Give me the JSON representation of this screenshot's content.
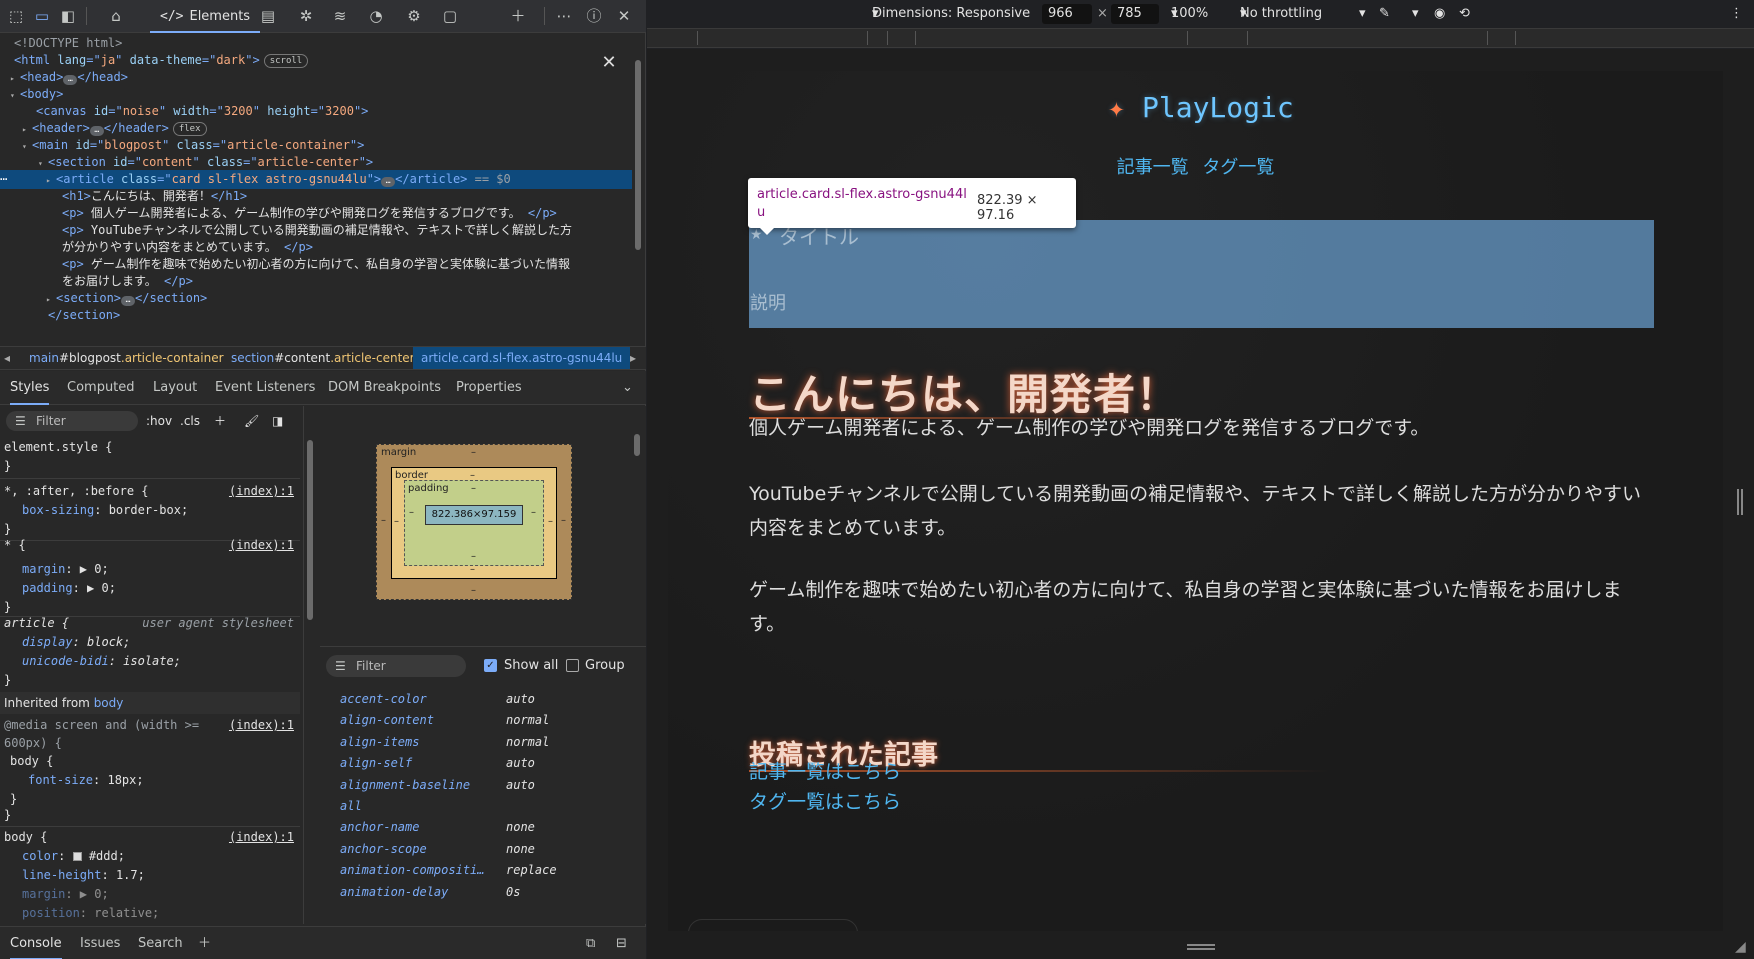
{
  "devtools": {
    "tabs": {
      "elements": "Elements"
    },
    "dom_lines": [
      {
        "parts": [
          [
            "c",
            "<!DOCTYPE html>"
          ]
        ]
      },
      {
        "parts": [
          [
            "t",
            "<html "
          ],
          [
            "a",
            "lang"
          ],
          [
            "t",
            "=\""
          ],
          [
            "v",
            "ja"
          ],
          [
            "t",
            "\" "
          ],
          [
            "a",
            "data-theme"
          ],
          [
            "t",
            "=\""
          ],
          [
            "v",
            "dark"
          ],
          [
            "t",
            "\">"
          ]
        ],
        "pill": "scroll"
      },
      {
        "parts": [
          [
            "t",
            "<head>"
          ],
          [
            "dots",
            "…"
          ],
          [
            "t",
            "</head>"
          ]
        ]
      },
      {
        "parts": [
          [
            "t",
            "<body>"
          ]
        ]
      },
      {
        "parts": [
          [
            "t",
            "<canvas "
          ],
          [
            "a",
            "id"
          ],
          [
            "t",
            "=\""
          ],
          [
            "v",
            "noise"
          ],
          [
            "t",
            "\" "
          ],
          [
            "a",
            "width"
          ],
          [
            "t",
            "=\""
          ],
          [
            "v",
            "3200"
          ],
          [
            "t",
            "\" "
          ],
          [
            "a",
            "height"
          ],
          [
            "t",
            "=\""
          ],
          [
            "v",
            "3200"
          ],
          [
            "t",
            "\">"
          ]
        ]
      },
      {
        "parts": [
          [
            "t",
            "<header>"
          ],
          [
            "dots",
            "…"
          ],
          [
            "t",
            "</header>"
          ]
        ],
        "pill": "flex"
      },
      {
        "parts": [
          [
            "t",
            "<main "
          ],
          [
            "a",
            "id"
          ],
          [
            "t",
            "=\""
          ],
          [
            "v",
            "blogpost"
          ],
          [
            "t",
            "\" "
          ],
          [
            "a",
            "class"
          ],
          [
            "t",
            "=\""
          ],
          [
            "v",
            "article-container"
          ],
          [
            "t",
            "\">"
          ]
        ]
      },
      {
        "parts": [
          [
            "t",
            "<section "
          ],
          [
            "a",
            "id"
          ],
          [
            "t",
            "=\""
          ],
          [
            "v",
            "content"
          ],
          [
            "t",
            "\" "
          ],
          [
            "a",
            "class"
          ],
          [
            "t",
            "=\""
          ],
          [
            "v",
            "article-center"
          ],
          [
            "t",
            "\">"
          ]
        ]
      },
      {
        "parts": [
          [
            "t",
            "<article "
          ],
          [
            "a",
            "class"
          ],
          [
            "t",
            "=\""
          ],
          [
            "v",
            "card sl-flex astro-gsnu44lu"
          ],
          [
            "t",
            "\">"
          ],
          [
            "dots",
            "…"
          ],
          [
            "t",
            "</article>"
          ],
          [
            "c",
            " == $0"
          ]
        ]
      },
      {
        "parts": [
          [
            "t",
            "<h1>"
          ],
          [
            "tx",
            "こんにちは、開発者！"
          ],
          [
            "t",
            "</h1>"
          ]
        ]
      },
      {
        "parts": [
          [
            "t",
            "<p>"
          ],
          [
            "tx",
            " 個人ゲーム開発者による、ゲーム制作の学びや開発ログを発信するブログです。 "
          ],
          [
            "t",
            "</p>"
          ]
        ]
      },
      {
        "parts": [
          [
            "t",
            "<p>"
          ],
          [
            "tx",
            " YouTubeチャンネルで公開している開発動画の補足情報や、テキストで詳しく解説した方"
          ]
        ]
      },
      {
        "parts": [
          [
            "tx",
            "が分かりやすい内容をまとめています。 "
          ],
          [
            "t",
            "</p>"
          ]
        ]
      },
      {
        "parts": [
          [
            "t",
            "<p>"
          ],
          [
            "tx",
            " ゲーム制作を趣味で始めたい初心者の方に向けて、私自身の学習と実体験に基づいた情報"
          ]
        ]
      },
      {
        "parts": [
          [
            "tx",
            "をお届けします。 "
          ],
          [
            "t",
            "</p>"
          ]
        ]
      },
      {
        "parts": [
          [
            "t",
            "<section>"
          ],
          [
            "dots",
            "…"
          ],
          [
            "t",
            "</section>"
          ]
        ]
      },
      {
        "parts": [
          [
            "t",
            "</section>"
          ]
        ]
      }
    ],
    "breadcrumbs": {
      "c1_tag": "main",
      "c1_id": "#blogpost",
      "c1_cls": ".article-container",
      "c2_tag": "section",
      "c2_id": "#content",
      "c2_cls": ".article-center",
      "c3": "article.card.sl-flex.astro-gsnu44lu"
    },
    "subtabs": [
      "Styles",
      "Computed",
      "Layout",
      "Event Listeners",
      "DOM Breakpoints",
      "Properties"
    ],
    "styles_filter": "Filter",
    "hov": ":hov",
    "cls": ".cls",
    "rules": {
      "element_style": "element.style {",
      "r1_sel": "*, :after, :before {",
      "r1_src": "(index):1",
      "r1_p1": "box-sizing",
      "r1_v1": "border-box;",
      "r2_sel": "* {",
      "r2_src": "(index):1",
      "r2_p1": "margin",
      "r2_v1": "0;",
      "r2_p2": "padding",
      "r2_v2": "0;",
      "r3_sel": "article {",
      "r3_ua": "user agent stylesheet",
      "r3_p1": "display",
      "r3_v1": "block;",
      "r3_p2": "unicode-bidi",
      "r3_v2": "isolate;",
      "inherited": "Inherited from",
      "inherited_el": "body",
      "r4_media": "@media screen and (width >=",
      "r4_media2": "600px) {",
      "r4_src": "(index):1",
      "r4_sel": "body {",
      "r4_p1": "font-size",
      "r4_v1": "18px;",
      "r5_sel": "body {",
      "r5_src": "(index):1",
      "r5_p1": "color",
      "r5_v1": "#ddd;",
      "r5_p2": "line-height",
      "r5_v2": "1.7;",
      "r5_p3": "margin",
      "r5_v3": "0;",
      "r5_p4": "position",
      "r5_v4": "relative;",
      "close": "}"
    },
    "boxmodel": {
      "margin": "margin",
      "border": "border",
      "padding": "padding",
      "content": "822.386×97.159",
      "dash": "–"
    },
    "computed_filter": "Filter",
    "show_all": "Show all",
    "group": "Group",
    "computed": [
      {
        "p": "accent-color",
        "v": "auto"
      },
      {
        "p": "align-content",
        "v": "normal"
      },
      {
        "p": "align-items",
        "v": "normal"
      },
      {
        "p": "align-self",
        "v": "auto"
      },
      {
        "p": "alignment-baseline",
        "v": "auto"
      },
      {
        "p": "all",
        "v": ""
      },
      {
        "p": "anchor-name",
        "v": "none"
      },
      {
        "p": "anchor-scope",
        "v": "none"
      },
      {
        "p": "animation-compositi…",
        "v": "replace"
      },
      {
        "p": "animation-delay",
        "v": "0s"
      }
    ],
    "drawer_tabs": [
      "Console",
      "Issues",
      "Search"
    ]
  },
  "device_toolbar": {
    "dimensions": "Dimensions: Responsive",
    "width": "966",
    "times": "×",
    "height": "785",
    "zoom": "100%",
    "throttle": "No throttling"
  },
  "page": {
    "logo": "PlayLogic",
    "nav": [
      "記事一覧",
      "タグ一覧"
    ],
    "tooltip_name": "article.card.sl-flex.astro-gsnu44lu",
    "tooltip_size": "822.39 × 97.16",
    "card_title": "タイトル",
    "card_desc": "説明",
    "h1": "こんにちは、開発者！",
    "p1": "個人ゲーム開発者による、ゲーム制作の学びや開発ログを発信するブログです。",
    "p2": "YouTubeチャンネルで公開している開発動画の補足情報や、テキストで詳しく解説した方が分かりやすい内容をまとめています。",
    "p3": "ゲーム制作を趣味で始めたい初心者の方に向けて、私自身の学習と実体験に基づいた情報をお届けします。",
    "h2": "投稿された記事",
    "link1": "記事一覧はこちら",
    "link2": "タグ一覧はこちら"
  },
  "colors": {
    "accent": "#7cacf8",
    "link": "#4fb6f0",
    "logo": "#6ec6ff",
    "selection": "#0e4a7d"
  }
}
